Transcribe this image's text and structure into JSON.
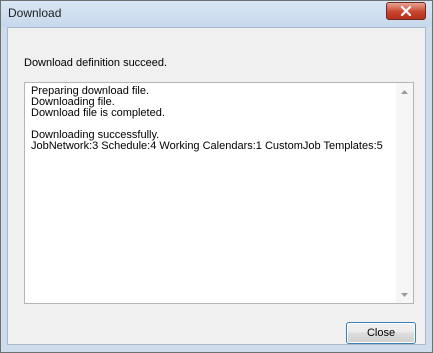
{
  "window": {
    "title": "Download"
  },
  "message": "Download definition succeed.",
  "log_lines": [
    "Preparing download file.",
    "Downloading file.",
    "Download file is completed.",
    "",
    "Downloading successfully.",
    "JobNetwork:3  Schedule:4 Working Calendars:1 CustomJob Templates:5"
  ],
  "buttons": {
    "close_label": "Close"
  },
  "icons": {
    "title_close": "close-icon",
    "scroll_up": "scroll-up-arrow-icon",
    "scroll_down": "scroll-down-arrow-icon"
  },
  "colors": {
    "title_close_button": "#c9452f",
    "titlebar": "#cfdcec",
    "default_button_border": "#3c7fb1"
  }
}
